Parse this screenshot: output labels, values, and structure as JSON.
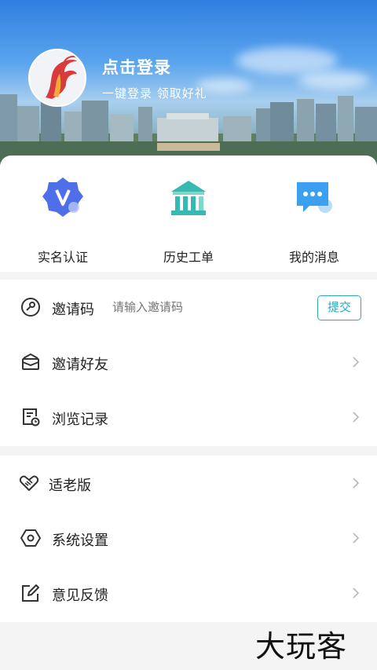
{
  "header": {
    "login_title": "点击登录",
    "login_subtitle": "一键登录 领取好礼"
  },
  "quick_actions": [
    {
      "label": "实名认证",
      "icon": "verified-badge-icon",
      "color": "#4f6fe8"
    },
    {
      "label": "历史工单",
      "icon": "government-building-icon",
      "color": "#36b9b0"
    },
    {
      "label": "我的消息",
      "icon": "message-bubble-icon",
      "color": "#3c9ff0"
    }
  ],
  "invite": {
    "label": "邀请码",
    "placeholder": "请输入邀请码",
    "submit_label": "提交"
  },
  "group1": [
    {
      "label": "邀请好友",
      "icon": "envelope-icon"
    },
    {
      "label": "浏览记录",
      "icon": "history-doc-icon"
    }
  ],
  "group2": [
    {
      "label": "适老版",
      "icon": "heart-hands-icon"
    },
    {
      "label": "系统设置",
      "icon": "hexagon-settings-icon"
    },
    {
      "label": "意见反馈",
      "icon": "edit-feedback-icon"
    }
  ],
  "watermark": "大玩客",
  "colors": {
    "accent": "#2aa8c4",
    "text": "#222222",
    "muted": "#9aa0a6"
  }
}
